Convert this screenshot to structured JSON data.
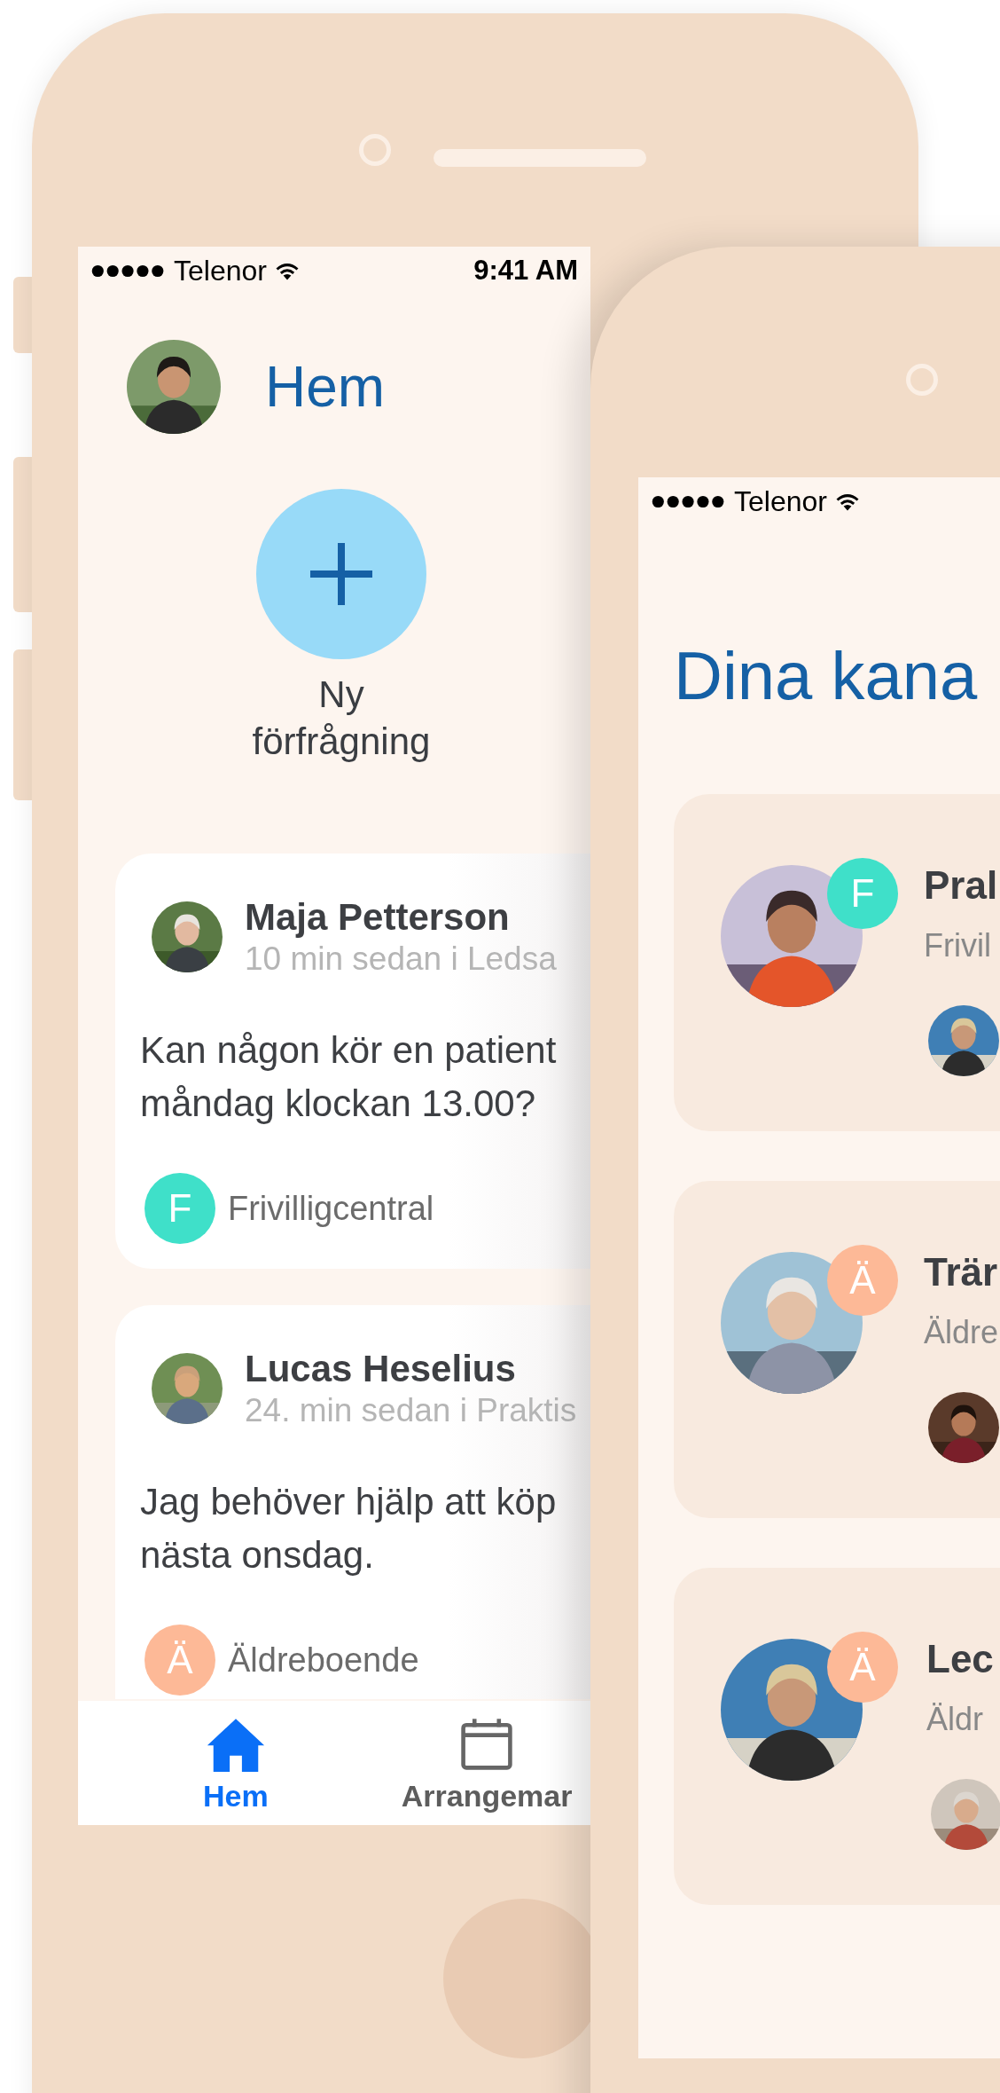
{
  "home_phone": {
    "status_bar": {
      "carrier": "Telenor",
      "time": "9:41 AM"
    },
    "header": {
      "title": "Hem"
    },
    "new_request": {
      "label": "Ny förfrågning"
    },
    "posts": [
      {
        "author": "Maja Petterson",
        "meta": "10 min sedan i Ledsa",
        "text_lines": [
          "Kan någon kör en patient",
          "måndag klockan 13.00?"
        ],
        "channel": {
          "initial": "F",
          "name": "Frivilligcentral",
          "color": "#3fe0c9"
        }
      },
      {
        "author": "Lucas Heselius",
        "meta": "24. min sedan i Praktis",
        "text_lines": [
          "Jag behöver hjälp att köp",
          "nästa onsdag."
        ],
        "channel": {
          "initial": "Ä",
          "name": "Äldreboende",
          "color": "#fdb997"
        }
      }
    ],
    "tabs": [
      {
        "kind": "home",
        "label": "Hem",
        "selected": true
      },
      {
        "kind": "calendar",
        "label": "Arrangemar",
        "selected": false
      }
    ]
  },
  "channels_phone": {
    "status_bar": {
      "carrier": "Telenor"
    },
    "title": "Dina kana",
    "channels": [
      {
        "title": "Pral",
        "subtitle": "Frivil",
        "initial": "F",
        "color": "#3fe0c9"
      },
      {
        "title": "Trär",
        "subtitle": "Äldre",
        "initial": "Ä",
        "color": "#fdb997"
      },
      {
        "title": "Lec",
        "subtitle": "Äldr",
        "initial": "Ä",
        "color": "#fdb997"
      }
    ]
  }
}
